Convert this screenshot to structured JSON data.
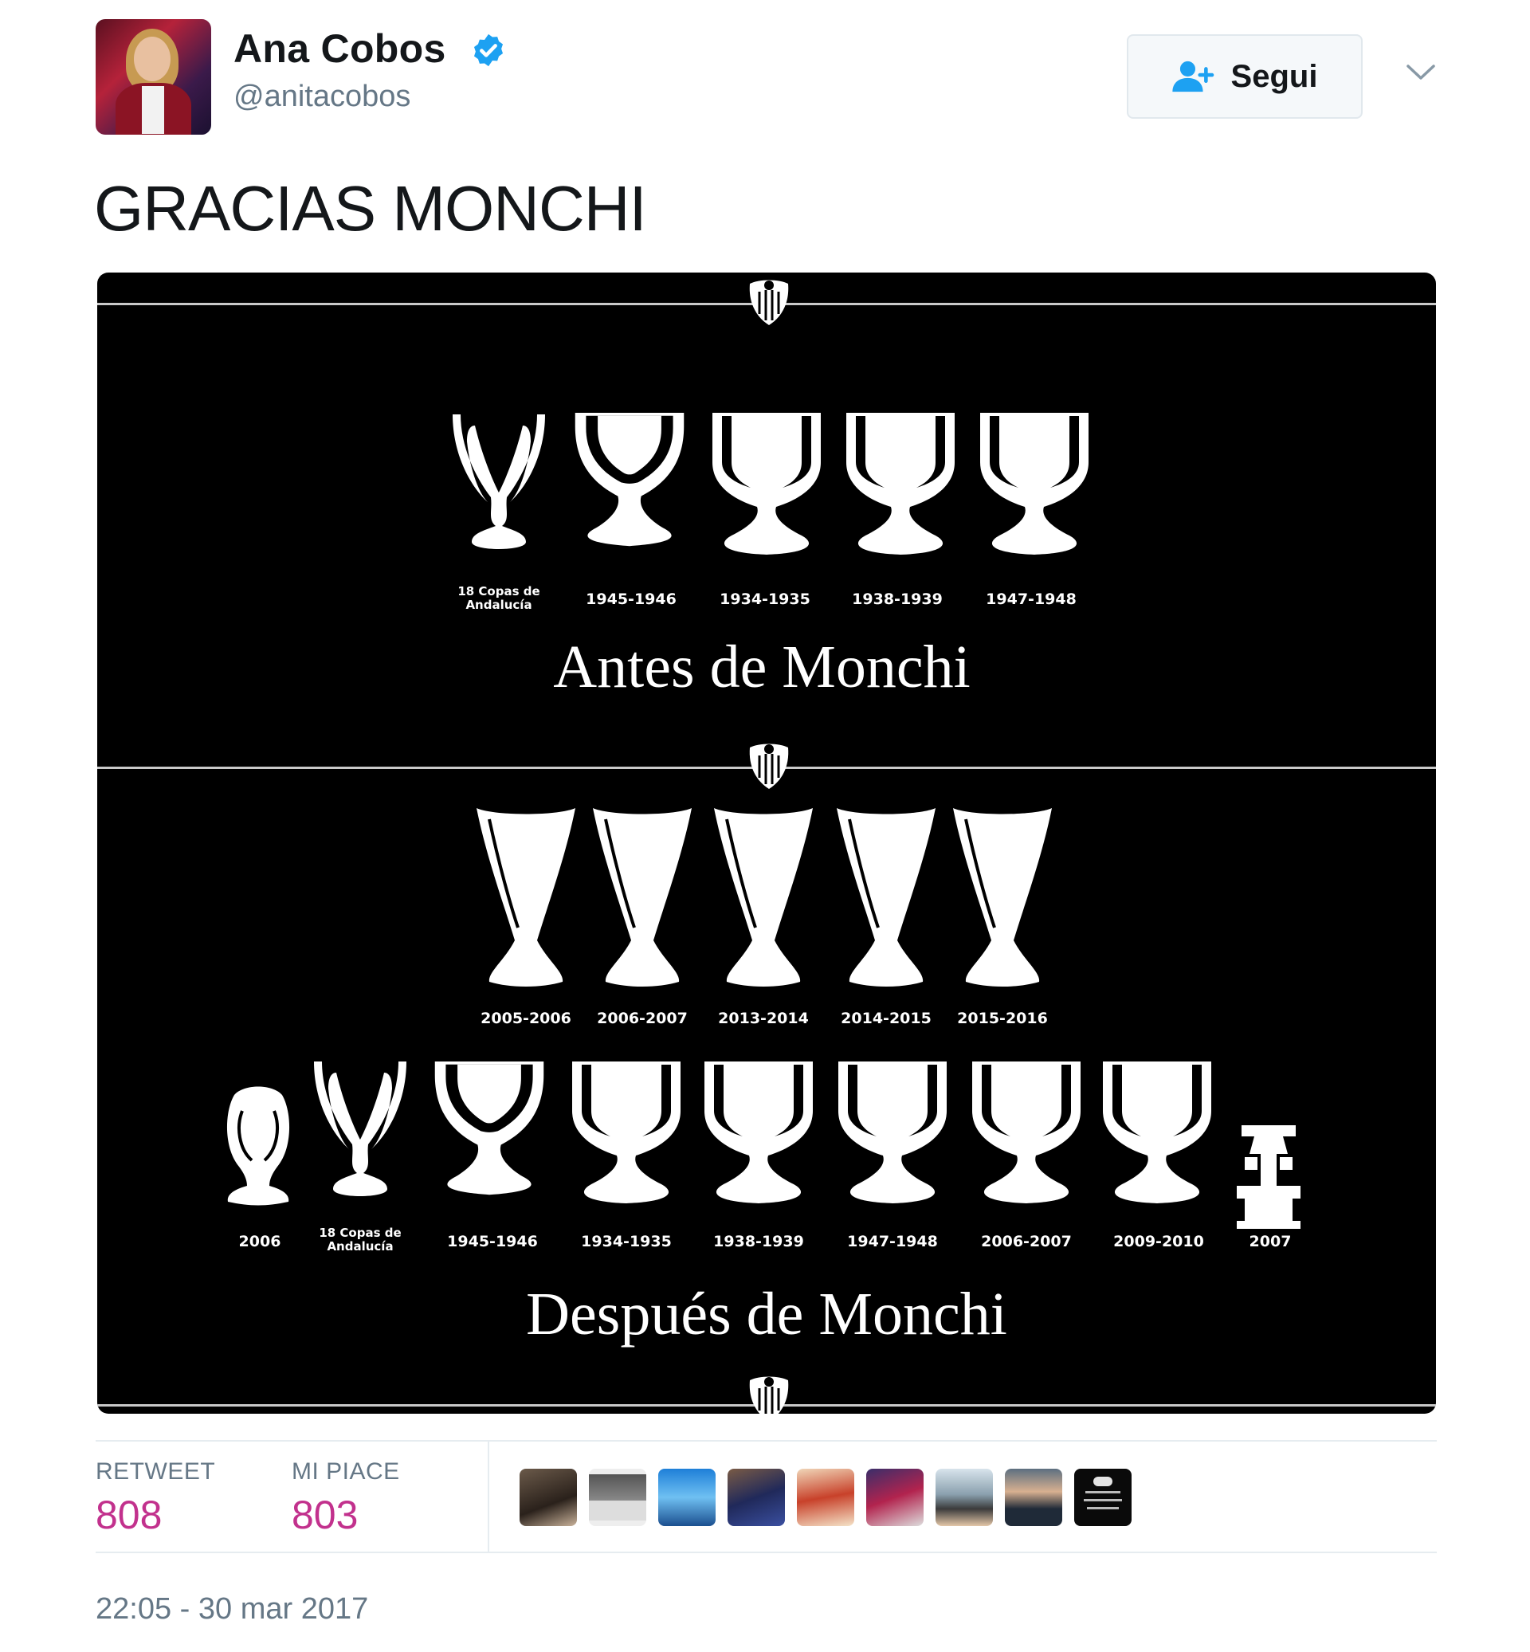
{
  "author": {
    "name": "Ana Cobos",
    "handle": "@anitacobos",
    "verified": true,
    "avatar_icon": "profile-photo"
  },
  "follow_button": {
    "label": "Segui",
    "icon": "add-user-icon"
  },
  "more_menu_icon": "chevron-down-icon",
  "tweet": {
    "text": "GRACIAS MONCHI"
  },
  "media": {
    "top_section": {
      "caption": "Antes de Monchi",
      "trophy_labels": [
        [
          "18 Copas de",
          "Andalucía"
        ],
        [
          "1945-1946"
        ],
        [
          "1934-1935"
        ],
        [
          "1938-1939"
        ],
        [
          "1947-1948"
        ]
      ]
    },
    "bottom_section": {
      "caption": "Después de Monchi",
      "uefa_labels": [
        "2005-2006",
        "2006-2007",
        "2013-2014",
        "2014-2015",
        "2015-2016"
      ],
      "trophy_labels": [
        [
          "2006"
        ],
        [
          "18 Copas de",
          "Andalucía"
        ],
        [
          "1945-1946"
        ],
        [
          "1934-1935"
        ],
        [
          "1938-1939"
        ],
        [
          "1947-1948"
        ],
        [
          "2006-2007"
        ],
        [
          "2009-2010"
        ],
        [
          "2007"
        ]
      ]
    },
    "crest_icon": "sevilla-crest-icon"
  },
  "stats": {
    "retweet_label": "RETWEET",
    "retweet_count": "808",
    "like_label": "MI PIACE",
    "like_count": "803"
  },
  "likers_count": 9,
  "timestamp": "22:05 - 30 mar 2017",
  "colors": {
    "accent": "#c2318d",
    "verified": "#1da1f2",
    "muted": "#657786",
    "divider": "#e6ecf0"
  }
}
